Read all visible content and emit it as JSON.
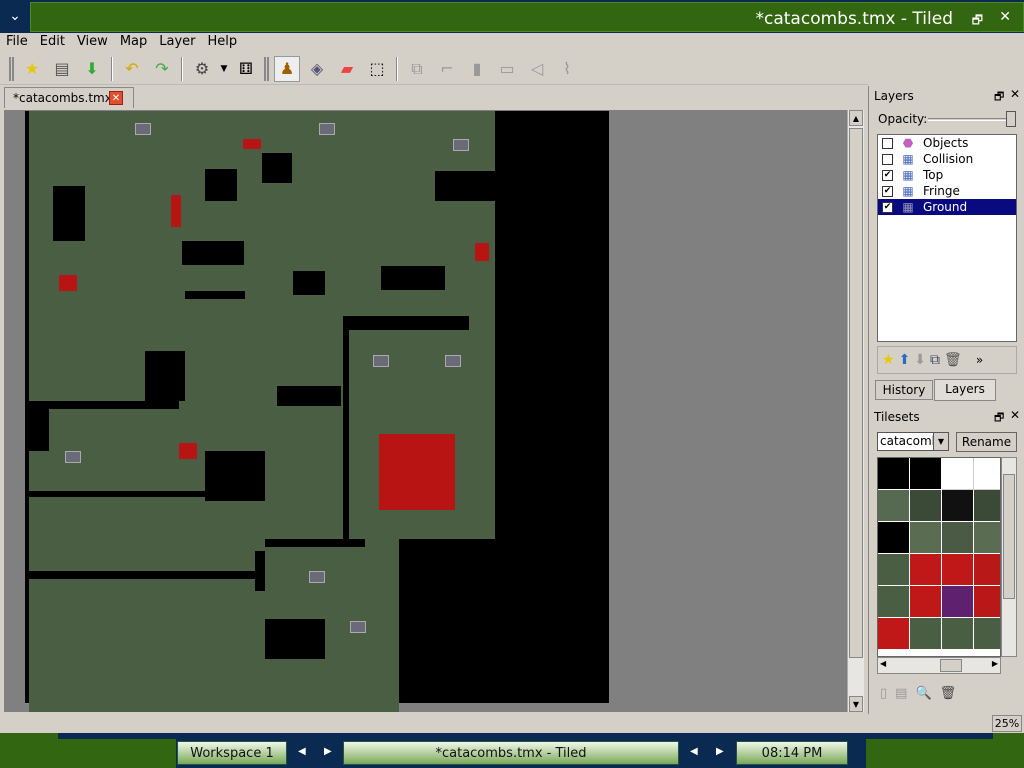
{
  "window": {
    "title": "*catacombs.tmx - Tiled"
  },
  "menu": [
    "File",
    "Edit",
    "View",
    "Map",
    "Layer",
    "Help"
  ],
  "toolbar": {
    "icons": [
      "new-icon",
      "open-icon",
      "save-icon",
      "undo-icon",
      "redo-icon",
      "commands-icon",
      "random-icon",
      "stamp-brush-icon",
      "bucket-fill-icon",
      "eraser-icon",
      "rect-select-icon",
      "select-objects-icon",
      "edit-polygons-icon",
      "insert-rect-icon",
      "insert-image-icon",
      "insert-polygon-icon",
      "insert-polyline-icon"
    ]
  },
  "document_tab": {
    "label": "*catacombs.tmx"
  },
  "layers_panel": {
    "title": "Layers",
    "opacity_label": "Opacity:",
    "opacity": 1.0,
    "layers": [
      {
        "name": "Objects",
        "visible": false,
        "type": "object"
      },
      {
        "name": "Collision",
        "visible": false,
        "type": "tile"
      },
      {
        "name": "Top",
        "visible": true,
        "type": "tile"
      },
      {
        "name": "Fringe",
        "visible": true,
        "type": "tile"
      },
      {
        "name": "Ground",
        "visible": true,
        "type": "tile",
        "selected": true
      }
    ],
    "more": "»"
  },
  "panel_tabs": [
    "History",
    "Layers"
  ],
  "tilesets_panel": {
    "title": "Tilesets",
    "selected": "catacombs",
    "rename_label": "Rename"
  },
  "status": {
    "zoom": "25%"
  },
  "taskbar": {
    "workspace": "Workspace 1",
    "task": "*catacombs.tmx - Tiled",
    "clock": "08:14 PM"
  },
  "colors": {
    "title_green": "#336611",
    "selection": "#0a0a80",
    "floor": "#4a5e44",
    "carpet": "#b81414"
  }
}
